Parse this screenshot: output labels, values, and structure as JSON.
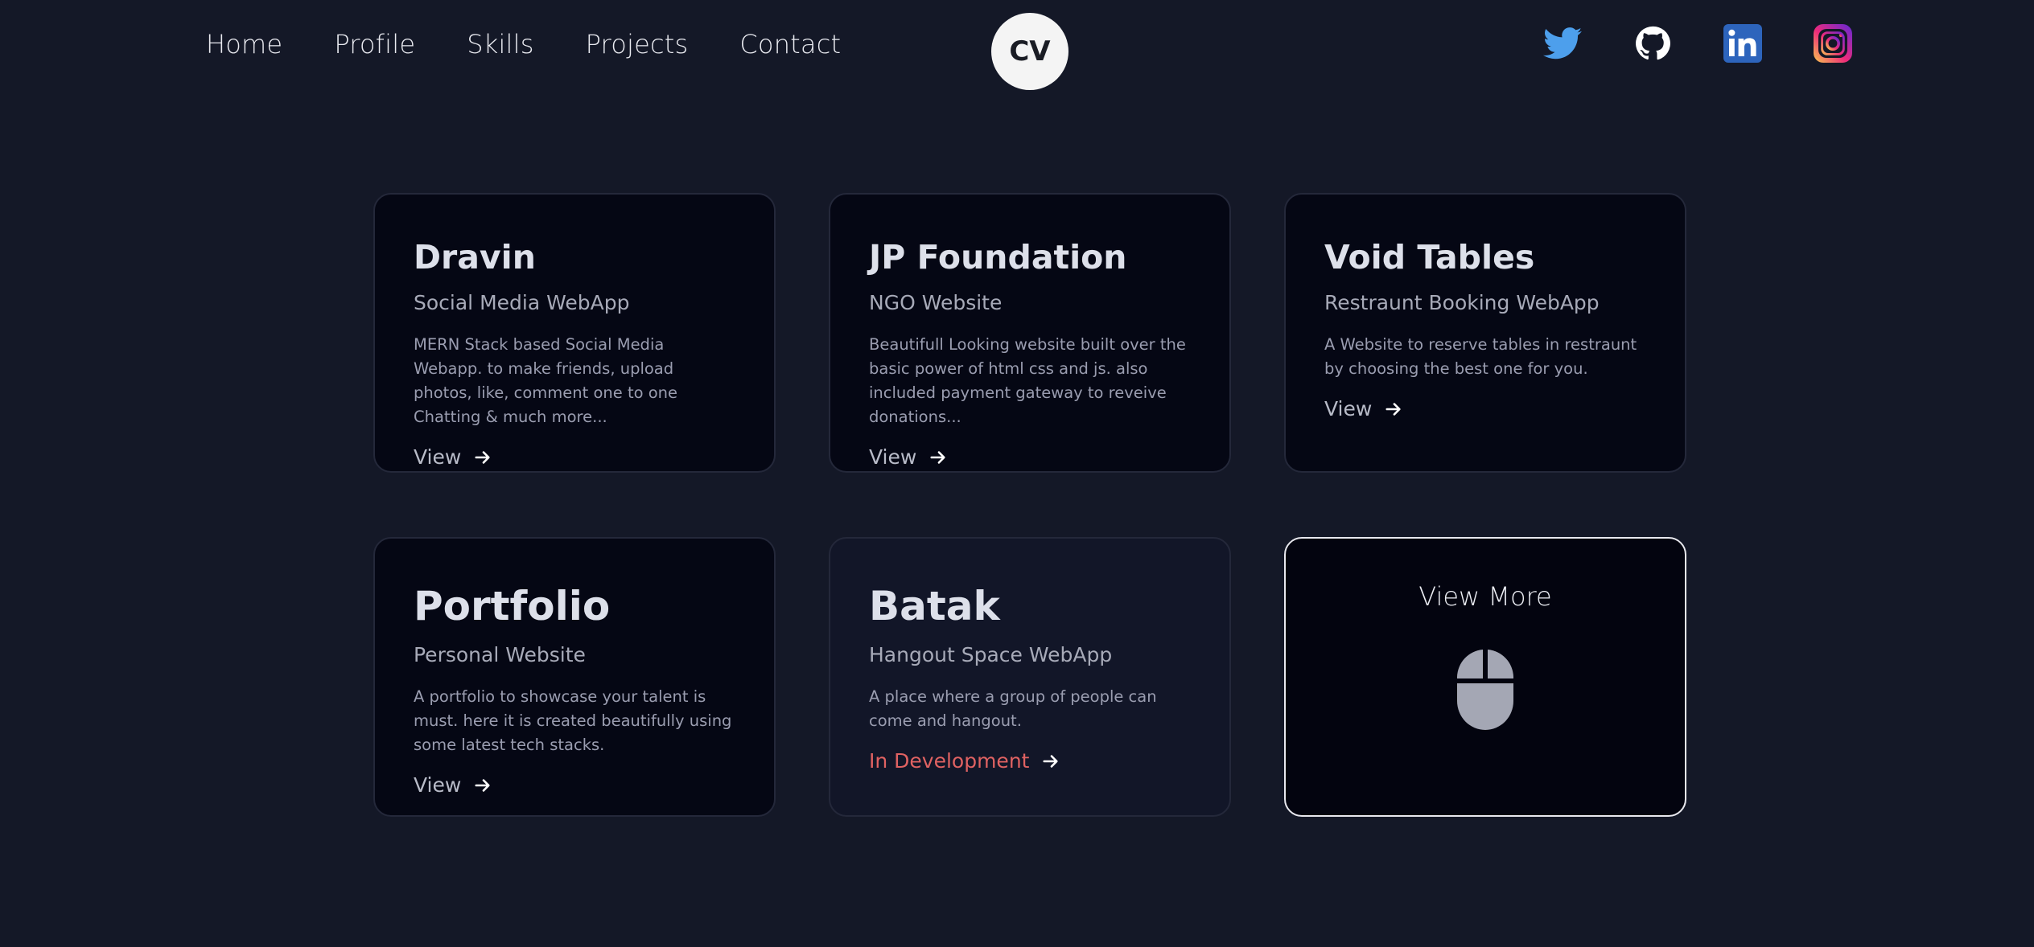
{
  "nav": {
    "links": [
      {
        "label": "Home"
      },
      {
        "label": "Profile"
      },
      {
        "label": "Skills"
      },
      {
        "label": "Projects"
      },
      {
        "label": "Contact"
      }
    ],
    "logo_text": "CV",
    "socials": [
      {
        "icon": "twitter-icon",
        "color": "#4d9fec"
      },
      {
        "icon": "github-icon",
        "color": "#ffffff"
      },
      {
        "icon": "linkedin-icon",
        "color": "#2d64bc"
      },
      {
        "icon": "instagram-icon",
        "color": "#dd2a7b"
      }
    ]
  },
  "projects": [
    {
      "title": "Dravin",
      "subtitle": "Social Media WebApp",
      "description": "MERN Stack based Social Media Webapp. to make friends, upload photos, like, comment one to one Chatting & much more...",
      "link_label": "View"
    },
    {
      "title": "JP Foundation",
      "subtitle": "NGO Website",
      "description": "Beautifull Looking website built over the basic power of html css and js. also included payment gateway to reveive donations...",
      "link_label": "View"
    },
    {
      "title": "Void Tables",
      "subtitle": "Restraunt Booking WebApp",
      "description": "A Website to reserve tables in restraunt by choosing the best one for you.",
      "link_label": "View"
    },
    {
      "title": "Portfolio",
      "subtitle": "Personal Website",
      "description": "A portfolio to showcase your talent is must. here it is created beautifully using some latest tech stacks.",
      "link_label": "View"
    },
    {
      "title": "Batak",
      "subtitle": "Hangout Space WebApp",
      "description": "A place where a group of people can come and hangout.",
      "link_label": "In Development",
      "status_color": "#e06262"
    }
  ],
  "view_more": {
    "label": "View More",
    "icon": "mouse-icon"
  },
  "colors": {
    "background": "#141827",
    "card": "#050714",
    "card_alt": "#121628",
    "dev_status": "#e06262"
  }
}
